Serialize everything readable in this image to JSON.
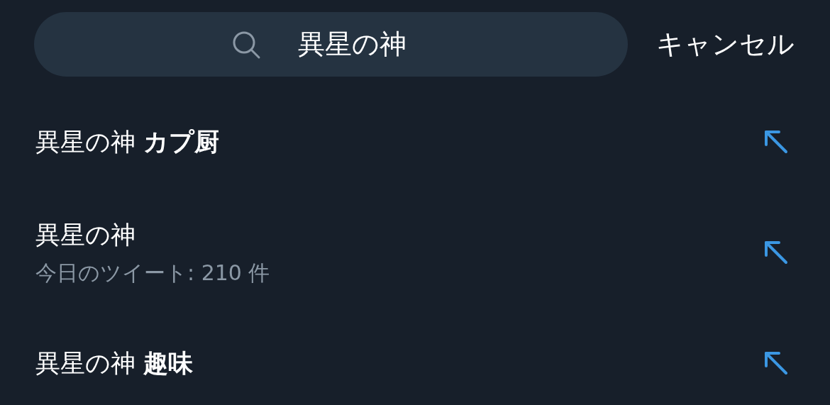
{
  "search": {
    "value": "異星の神"
  },
  "cancel": "キャンセル",
  "suggestions": [
    {
      "text": "異星の神 **カプ厨**"
    },
    {
      "text": "異星の神",
      "subtitle": "今日のツイート: 210 件"
    },
    {
      "text": "異星の神 **趣味**"
    }
  ]
}
